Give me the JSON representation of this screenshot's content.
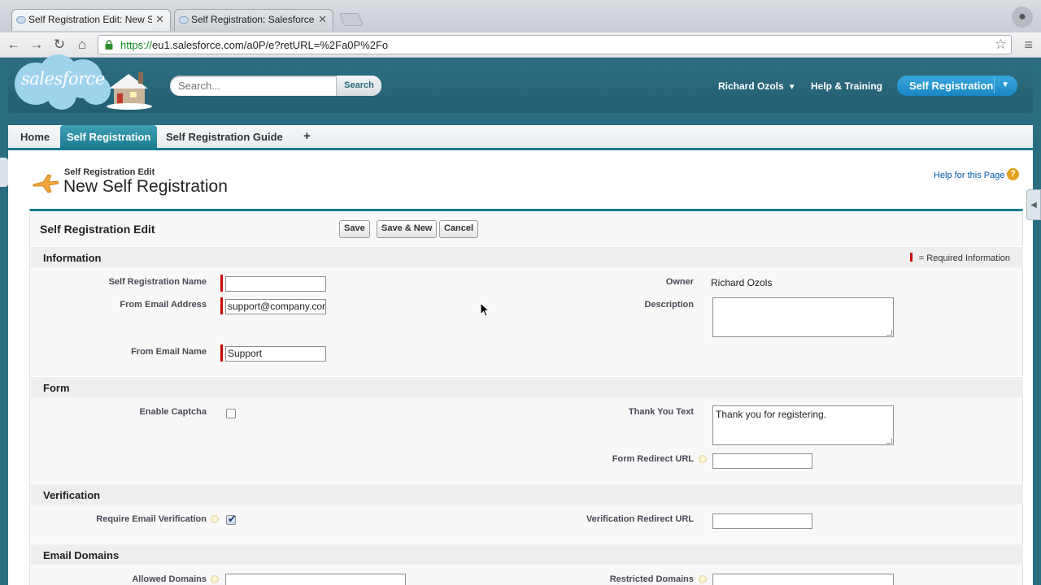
{
  "browser": {
    "tabs": [
      {
        "title": "Self Registration Edit: New Se"
      },
      {
        "title": "Self Registration: Salesforce E"
      }
    ],
    "url_scheme": "https://",
    "url_rest": "eu1.salesforce.com/a0P/e?retURL=%2Fa0P%2Fo"
  },
  "header": {
    "logo_text": "salesforce",
    "search_placeholder": "Search...",
    "search_button": "Search",
    "user_name": "Richard Ozols",
    "help_link": "Help & Training",
    "app_menu": "Self Registration"
  },
  "tabs": [
    {
      "label": "Home"
    },
    {
      "label": "Self Registration"
    },
    {
      "label": "Self Registration Guide"
    },
    {
      "label": "+"
    }
  ],
  "page": {
    "type_label": "Self Registration Edit",
    "title": "New Self Registration",
    "help_link": "Help for this Page",
    "help_icon": "?"
  },
  "block": {
    "title": "Self Registration Edit",
    "save_button": "Save",
    "save_new_button": "Save & New",
    "cancel_button": "Cancel"
  },
  "sections": {
    "information": {
      "title": "Information",
      "required_note": "= Required Information",
      "name_label": "Self Registration Name",
      "name_value": "",
      "from_email_label": "From Email Address",
      "from_email_value": "support@company.com",
      "from_name_label": "From Email Name",
      "from_name_value": "Support",
      "owner_label": "Owner",
      "owner_value": "Richard Ozols",
      "description_label": "Description",
      "description_value": ""
    },
    "form": {
      "title": "Form",
      "captcha_label": "Enable Captcha",
      "captcha_checked": false,
      "thank_you_label": "Thank You Text",
      "thank_you_value": "Thank you for registering.",
      "redirect_label": "Form Redirect URL",
      "redirect_value": ""
    },
    "verification": {
      "title": "Verification",
      "require_label": "Require Email Verification",
      "require_checked": true,
      "redirect_label": "Verification Redirect URL",
      "redirect_value": ""
    },
    "email_domains": {
      "title": "Email Domains",
      "allowed_label": "Allowed Domains",
      "restricted_label": "Restricted Domains"
    }
  },
  "colors": {
    "header_teal": "#2b6d80",
    "active_tab": "#1d7d92",
    "required_red": "#cc0000",
    "link_blue": "#015ba7"
  }
}
